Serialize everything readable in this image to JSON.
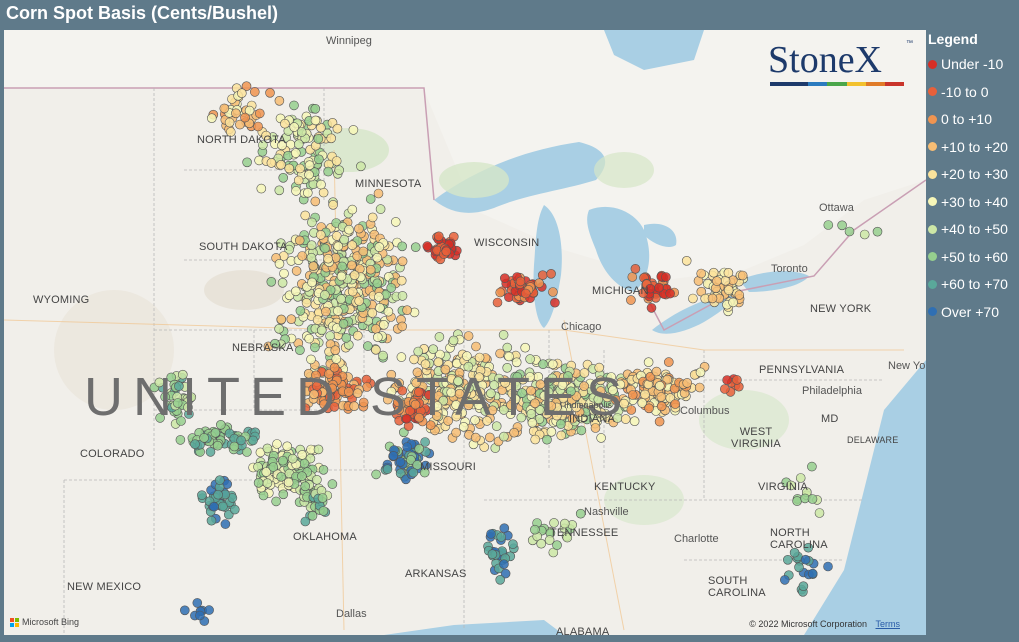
{
  "title": "Corn Spot Basis (Cents/Bushel)",
  "legend": {
    "title": "Legend",
    "items": [
      {
        "label": "Under -10",
        "color": "#d62e26"
      },
      {
        "label": "-10 to 0",
        "color": "#e8603a"
      },
      {
        "label": "0 to +10",
        "color": "#f09450"
      },
      {
        "label": "+10 to +20",
        "color": "#f7bd74"
      },
      {
        "label": "+20 to +30",
        "color": "#fbe39c"
      },
      {
        "label": "+30 to +40",
        "color": "#f7f7b8"
      },
      {
        "label": "+40 to +50",
        "color": "#cde7a6"
      },
      {
        "label": "+50 to +60",
        "color": "#96cf8e"
      },
      {
        "label": "+60 to +70",
        "color": "#5aa89a"
      },
      {
        "label": "Over +70",
        "color": "#2f6fb3"
      }
    ]
  },
  "logo": {
    "text": "StoneX",
    "tm": "™",
    "bar_colors": [
      "#1d3a6b",
      "#1d3a6b",
      "#2b7bbf",
      "#4aa64a",
      "#f2c12e",
      "#e07b28",
      "#c9342b"
    ]
  },
  "map_labels": {
    "country": "UNITED STATES",
    "states": [
      {
        "name": "NORTH DAKOTA"
      },
      {
        "name": "MINNESOTA"
      },
      {
        "name": "SOUTH DAKOTA"
      },
      {
        "name": "WYOMING"
      },
      {
        "name": "NEBRASKA"
      },
      {
        "name": "COLORADO"
      },
      {
        "name": "MISSOURI"
      },
      {
        "name": "OKLAHOMA"
      },
      {
        "name": "ARKANSAS"
      },
      {
        "name": "NEW MEXICO"
      },
      {
        "name": "KENTUCKY"
      },
      {
        "name": "TENNESSEE"
      },
      {
        "name": "WEST VIRGINIA"
      },
      {
        "name": "VIRGINIA"
      },
      {
        "name": "PENNSYLVANIA"
      },
      {
        "name": "NEW YORK"
      },
      {
        "name": "NORTH CAROLINA"
      },
      {
        "name": "SOUTH CAROLINA"
      },
      {
        "name": "DELAWARE"
      },
      {
        "name": "MD"
      },
      {
        "name": "WISCONSIN"
      },
      {
        "name": "MICHIGAN"
      },
      {
        "name": "INDIANA"
      },
      {
        "name": "ALABAMA"
      }
    ],
    "cities": [
      {
        "name": "Winnipeg"
      },
      {
        "name": "Ottawa"
      },
      {
        "name": "Toronto"
      },
      {
        "name": "Chicago"
      },
      {
        "name": "Nashville"
      },
      {
        "name": "Charlotte"
      },
      {
        "name": "Dallas"
      },
      {
        "name": "Philadelphia"
      },
      {
        "name": "Columbus"
      },
      {
        "name": "Indianapolis"
      },
      {
        "name": "New York"
      }
    ]
  },
  "attribution": {
    "copyright": "© 2022 Microsoft Corporation",
    "terms": "Terms",
    "bing": "Microsoft Bing"
  }
}
